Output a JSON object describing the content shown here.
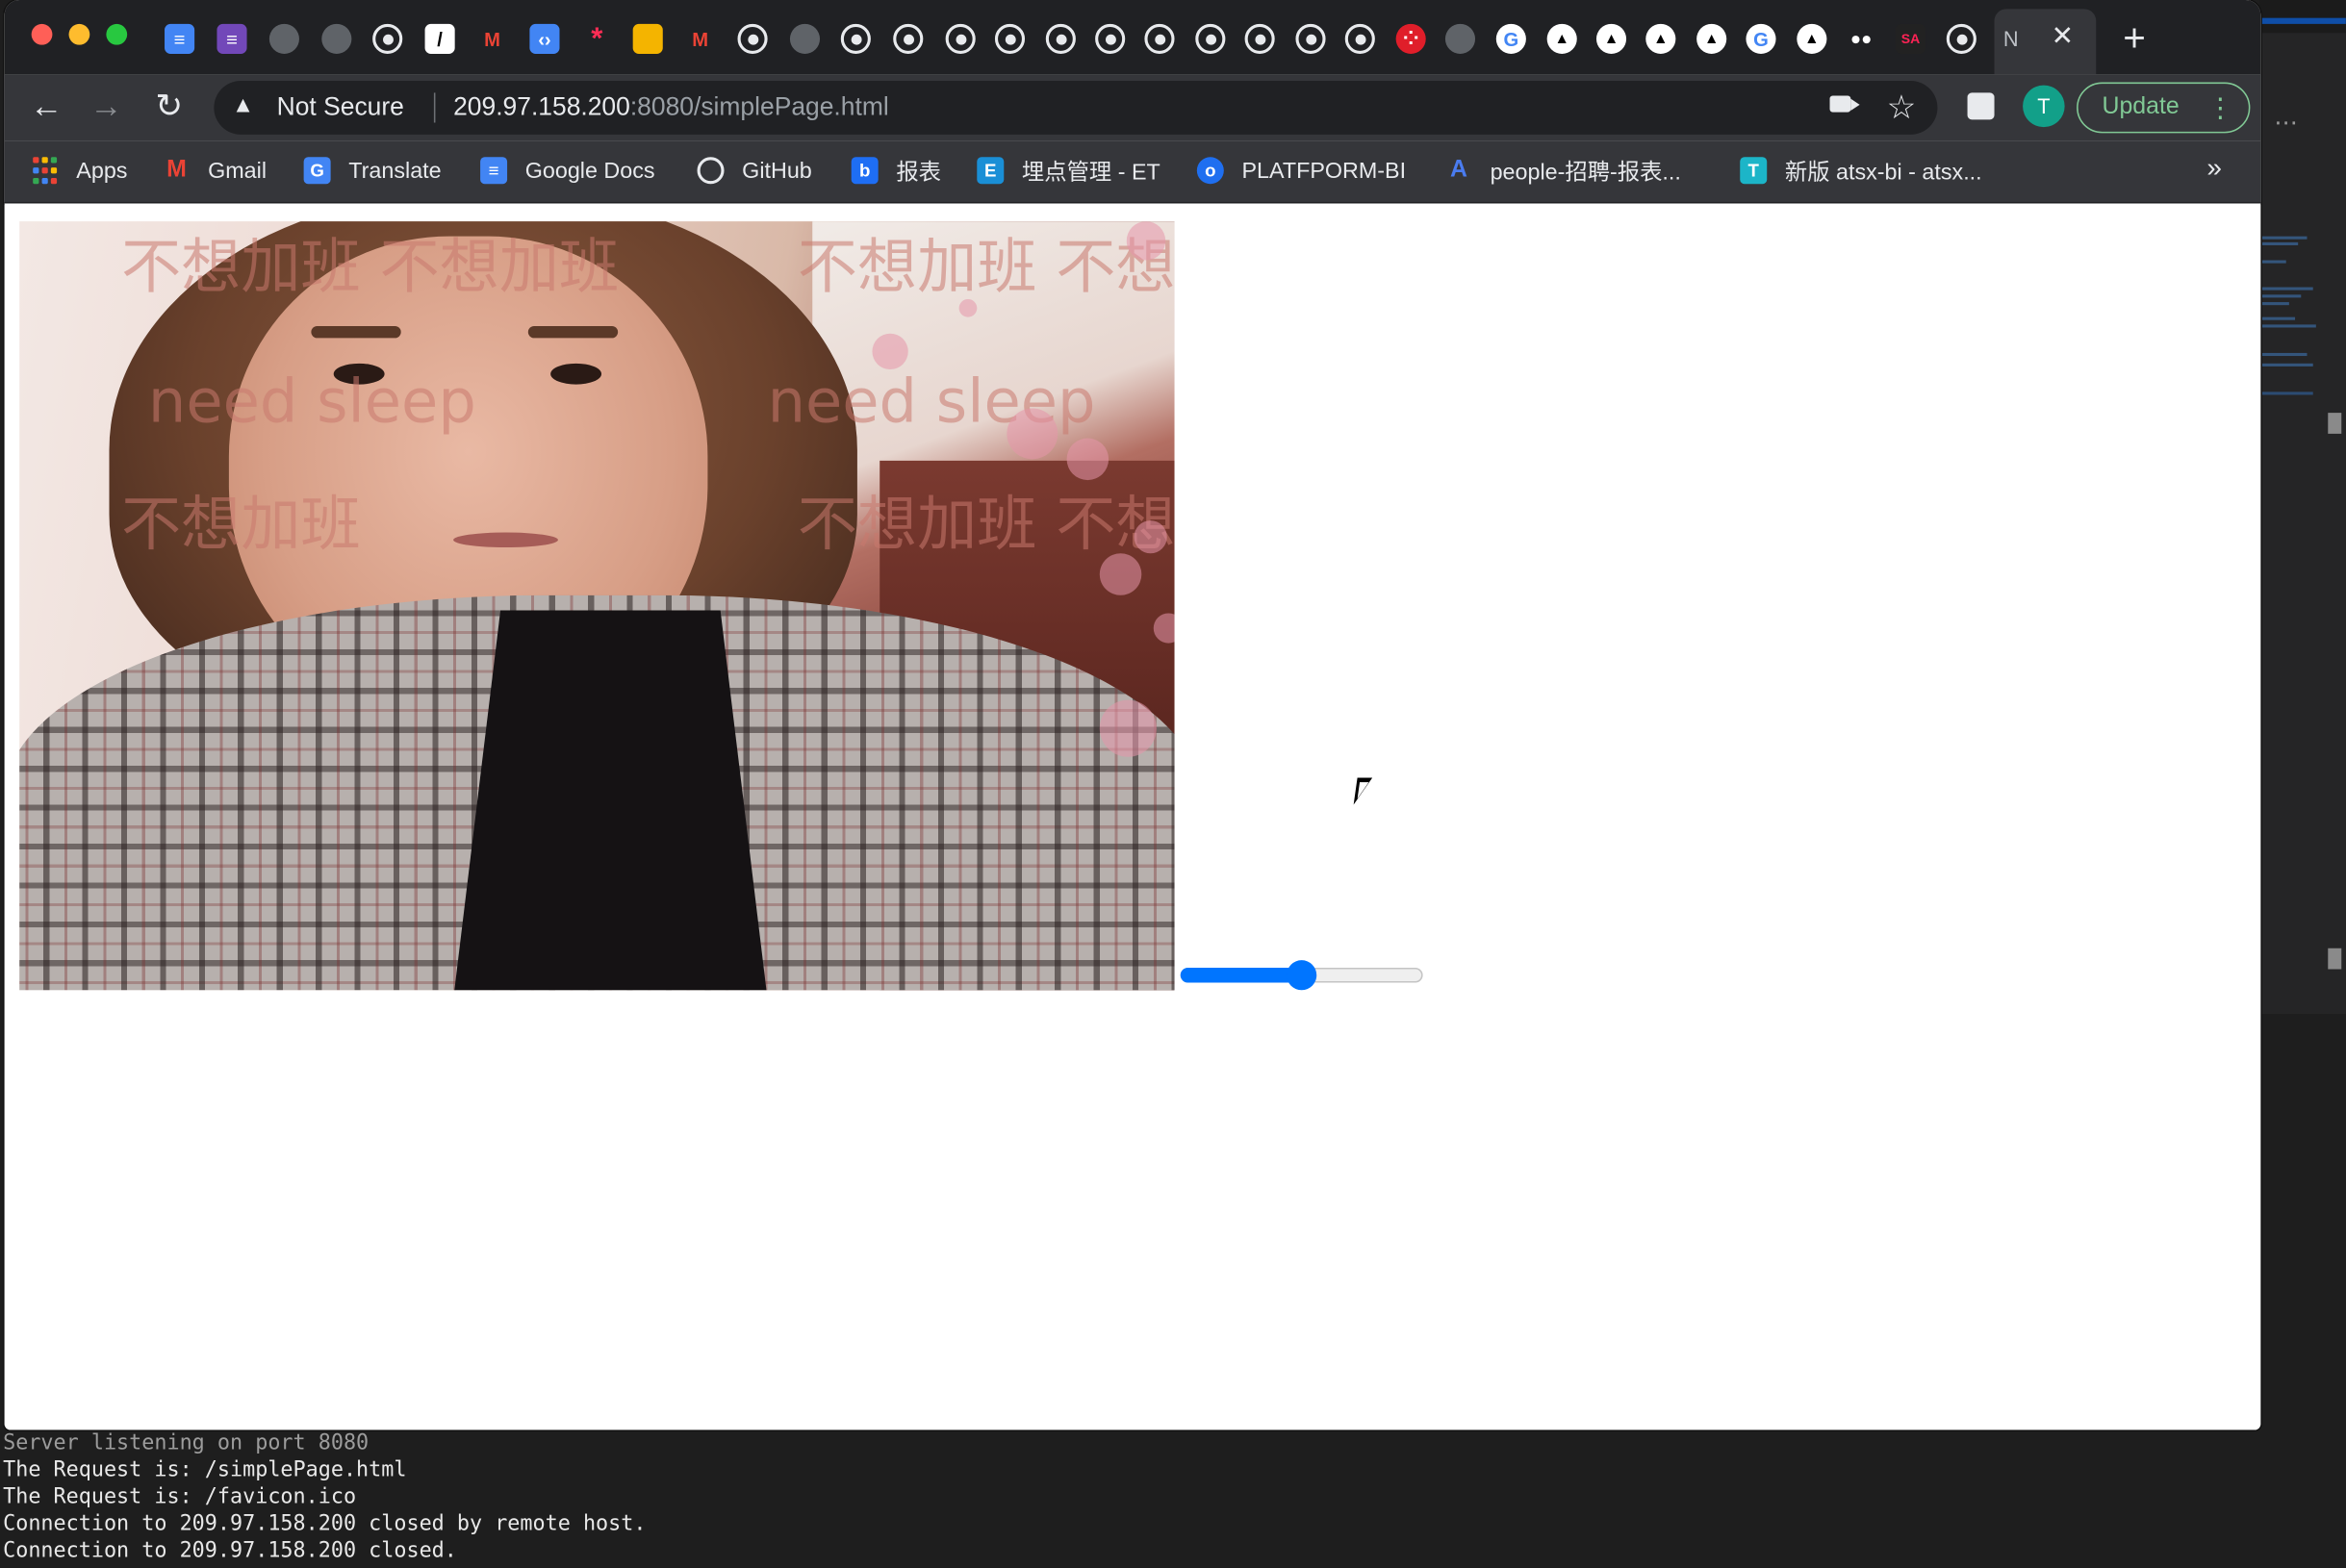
{
  "browser": {
    "tab_last_label": "N",
    "address": {
      "security_label": "Not Secure",
      "host": "209.97.158.200",
      "path": ":8080/simplePage.html"
    },
    "profile_initial": "T",
    "update_label": "Update",
    "bookmarks": [
      {
        "label": "Apps",
        "icon": "apps-grid-icon"
      },
      {
        "label": "Gmail",
        "icon": "gmail-icon"
      },
      {
        "label": "Translate",
        "icon": "translate-icon"
      },
      {
        "label": "Google Docs",
        "icon": "docs-icon"
      },
      {
        "label": "GitHub",
        "icon": "github-icon"
      },
      {
        "label": "报表",
        "icon": "b-icon"
      },
      {
        "label": "埋点管理 - ET",
        "icon": "e-icon"
      },
      {
        "label": "PLATFPORM-BI",
        "icon": "platform-icon"
      },
      {
        "label": "people-招聘-报表...",
        "icon": "a-icon"
      },
      {
        "label": "新版 atsx-bi - atsx...",
        "icon": "t-icon"
      }
    ],
    "bookmarks_more": "»"
  },
  "page": {
    "video_watermark_1": "不想加班 不想加班",
    "video_watermark_2": "need sleep",
    "video_watermark_3": "不想加班",
    "slider_value": 0.5,
    "accent_color": "#0075ff"
  },
  "terminal": {
    "lines": [
      "Server listening on port 8080",
      "The Request is: /simplePage.html",
      "The Request is: /favicon.ico",
      "Connection to 209.97.158.200 closed by remote host.",
      "Connection to 209.97.158.200 closed."
    ]
  }
}
